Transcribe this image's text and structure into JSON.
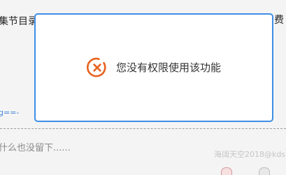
{
  "background": {
    "title_left": "集节目录",
    "title_right": "费",
    "link_text": "g==-",
    "empty_comment_text": "什么也没留下......",
    "watermark": "海阔天空2018@kds"
  },
  "toast": {
    "message": "您没有权限使用该功能",
    "icon": "error-circle-x-icon",
    "border_color": "#3d8ee6",
    "icon_color": "#e8621e"
  }
}
